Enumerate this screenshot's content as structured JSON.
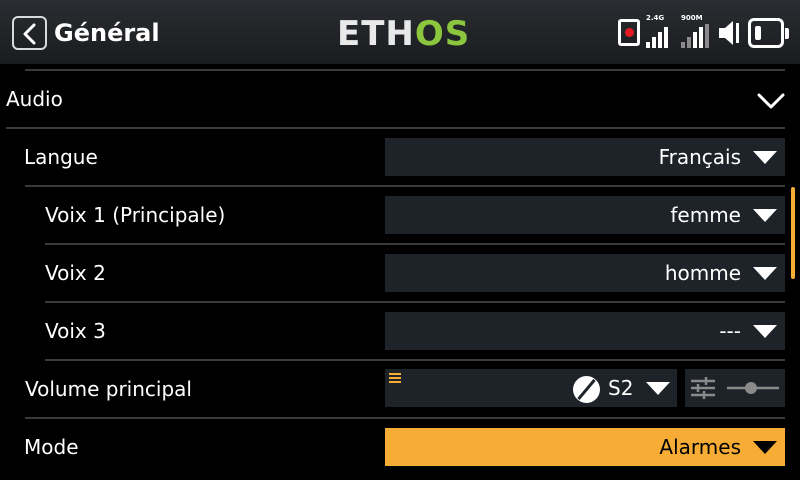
{
  "header": {
    "title": "Général",
    "logo_left": "ETH",
    "logo_right": "OS",
    "rf_label_1": "2.4G",
    "rf_label_2": "900M",
    "icons": [
      "back-icon",
      "record-icon",
      "signal-2-4g-icon",
      "signal-900m-icon",
      "speaker-icon",
      "battery-icon"
    ]
  },
  "section": {
    "title": "Audio",
    "chevron": "chevron-down-icon"
  },
  "rows": {
    "langue": {
      "label": "Langue",
      "value": "Français"
    },
    "voix1": {
      "label": "Voix 1 (Principale)",
      "value": "femme"
    },
    "voix2": {
      "label": "Voix 2",
      "value": "homme"
    },
    "voix3": {
      "label": "Voix 3",
      "value": "---"
    },
    "volume": {
      "label": "Volume principal",
      "source": "S2"
    },
    "mode": {
      "label": "Mode",
      "value": "Alarmes"
    }
  },
  "colors": {
    "accent": "#f7ad35",
    "field_bg": "#1d2329",
    "logo_green": "#8cc63f",
    "record_red": "#e51b24"
  }
}
